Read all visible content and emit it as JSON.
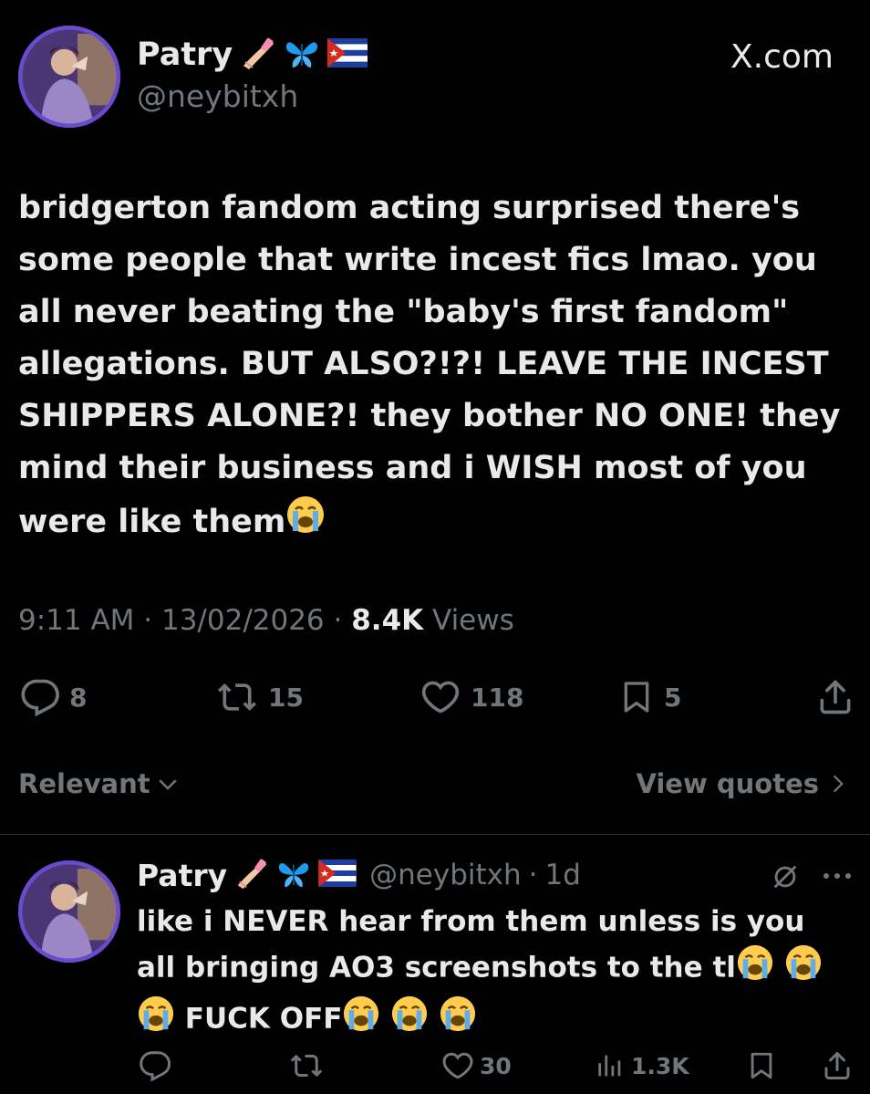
{
  "main_tweet": {
    "display_name": "Patry",
    "handle": "@neybitxh",
    "site_label": "X.com",
    "text": "bridgerton fandom acting surprised there's some people that write incest fics lmao. you all never beating the \"baby's first fandom\" allegations. BUT ALSO?!?! LEAVE THE INCEST SHIPPERS ALONE?! they bother NO ONE! they mind their business and i WISH most of you were like them",
    "time": "9:11 AM",
    "date": "13/02/2026",
    "views_count": "8.4K",
    "views_label": "Views",
    "replies": "8",
    "reposts": "15",
    "likes": "118",
    "bookmarks": "5"
  },
  "filter": {
    "sort_label": "Relevant",
    "quotes_label": "View quotes"
  },
  "reply": {
    "display_name": "Patry",
    "handle": "@neybitxh",
    "age": "1d",
    "text_line1": "like i NEVER hear from them unless is you",
    "text_line2": "all bringing AO3 screenshots to the tl",
    "text_line3": "FUCK OFF",
    "replies": "",
    "reposts": "",
    "likes": "30",
    "views": "1.3K"
  },
  "icons": [
    "nail-polish-emoji",
    "butterfly-emoji",
    "cuba-flag-emoji",
    "crying-face-emoji",
    "reply-icon",
    "repost-icon",
    "like-icon",
    "bookmark-icon",
    "share-icon",
    "views-icon",
    "grok-icon",
    "more-icon",
    "chevron-down-icon",
    "chevron-right-icon"
  ],
  "colors": {
    "background": "#000000",
    "text": "#e7e9ea",
    "muted": "#71767b",
    "divider": "#2f3336",
    "butterfly": "#1d9bf0"
  }
}
